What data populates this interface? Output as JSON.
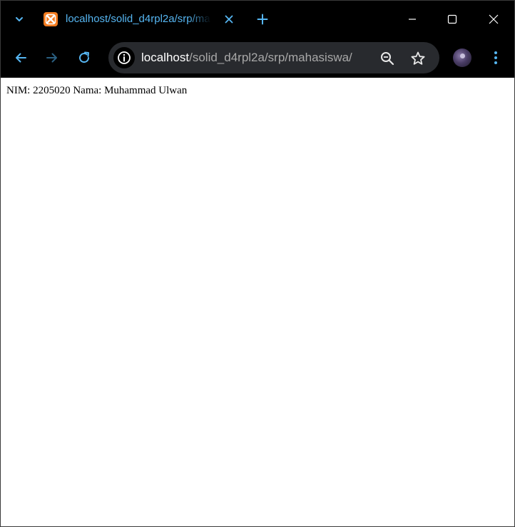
{
  "tab": {
    "title": "localhost/solid_d4rpl2a/srp/mahasiswa/",
    "favicon": "xampp-icon"
  },
  "address_bar": {
    "host": "localhost",
    "path": "/solid_d4rpl2a/srp/mahasiswa/"
  },
  "page": {
    "content": "NIM: 2205020 Nama: Muhammad Ulwan"
  },
  "icons": {
    "tab_search": "chevron-down-icon",
    "tab_close": "close-icon",
    "new_tab": "plus-icon",
    "minimize": "minimize-icon",
    "maximize": "maximize-icon",
    "close_window": "close-icon",
    "back": "arrow-left-icon",
    "forward": "arrow-right-icon",
    "reload": "reload-icon",
    "site_info": "info-icon",
    "zoom": "zoom-out-icon",
    "bookmark": "star-icon",
    "profile": "avatar",
    "menu": "more-vertical-icon"
  },
  "colors": {
    "chrome_background": "#000000",
    "accent": "#56b6f2",
    "favicon": "#f57c1f",
    "omnibox": "#282a2e",
    "page_background": "#ffffff"
  }
}
